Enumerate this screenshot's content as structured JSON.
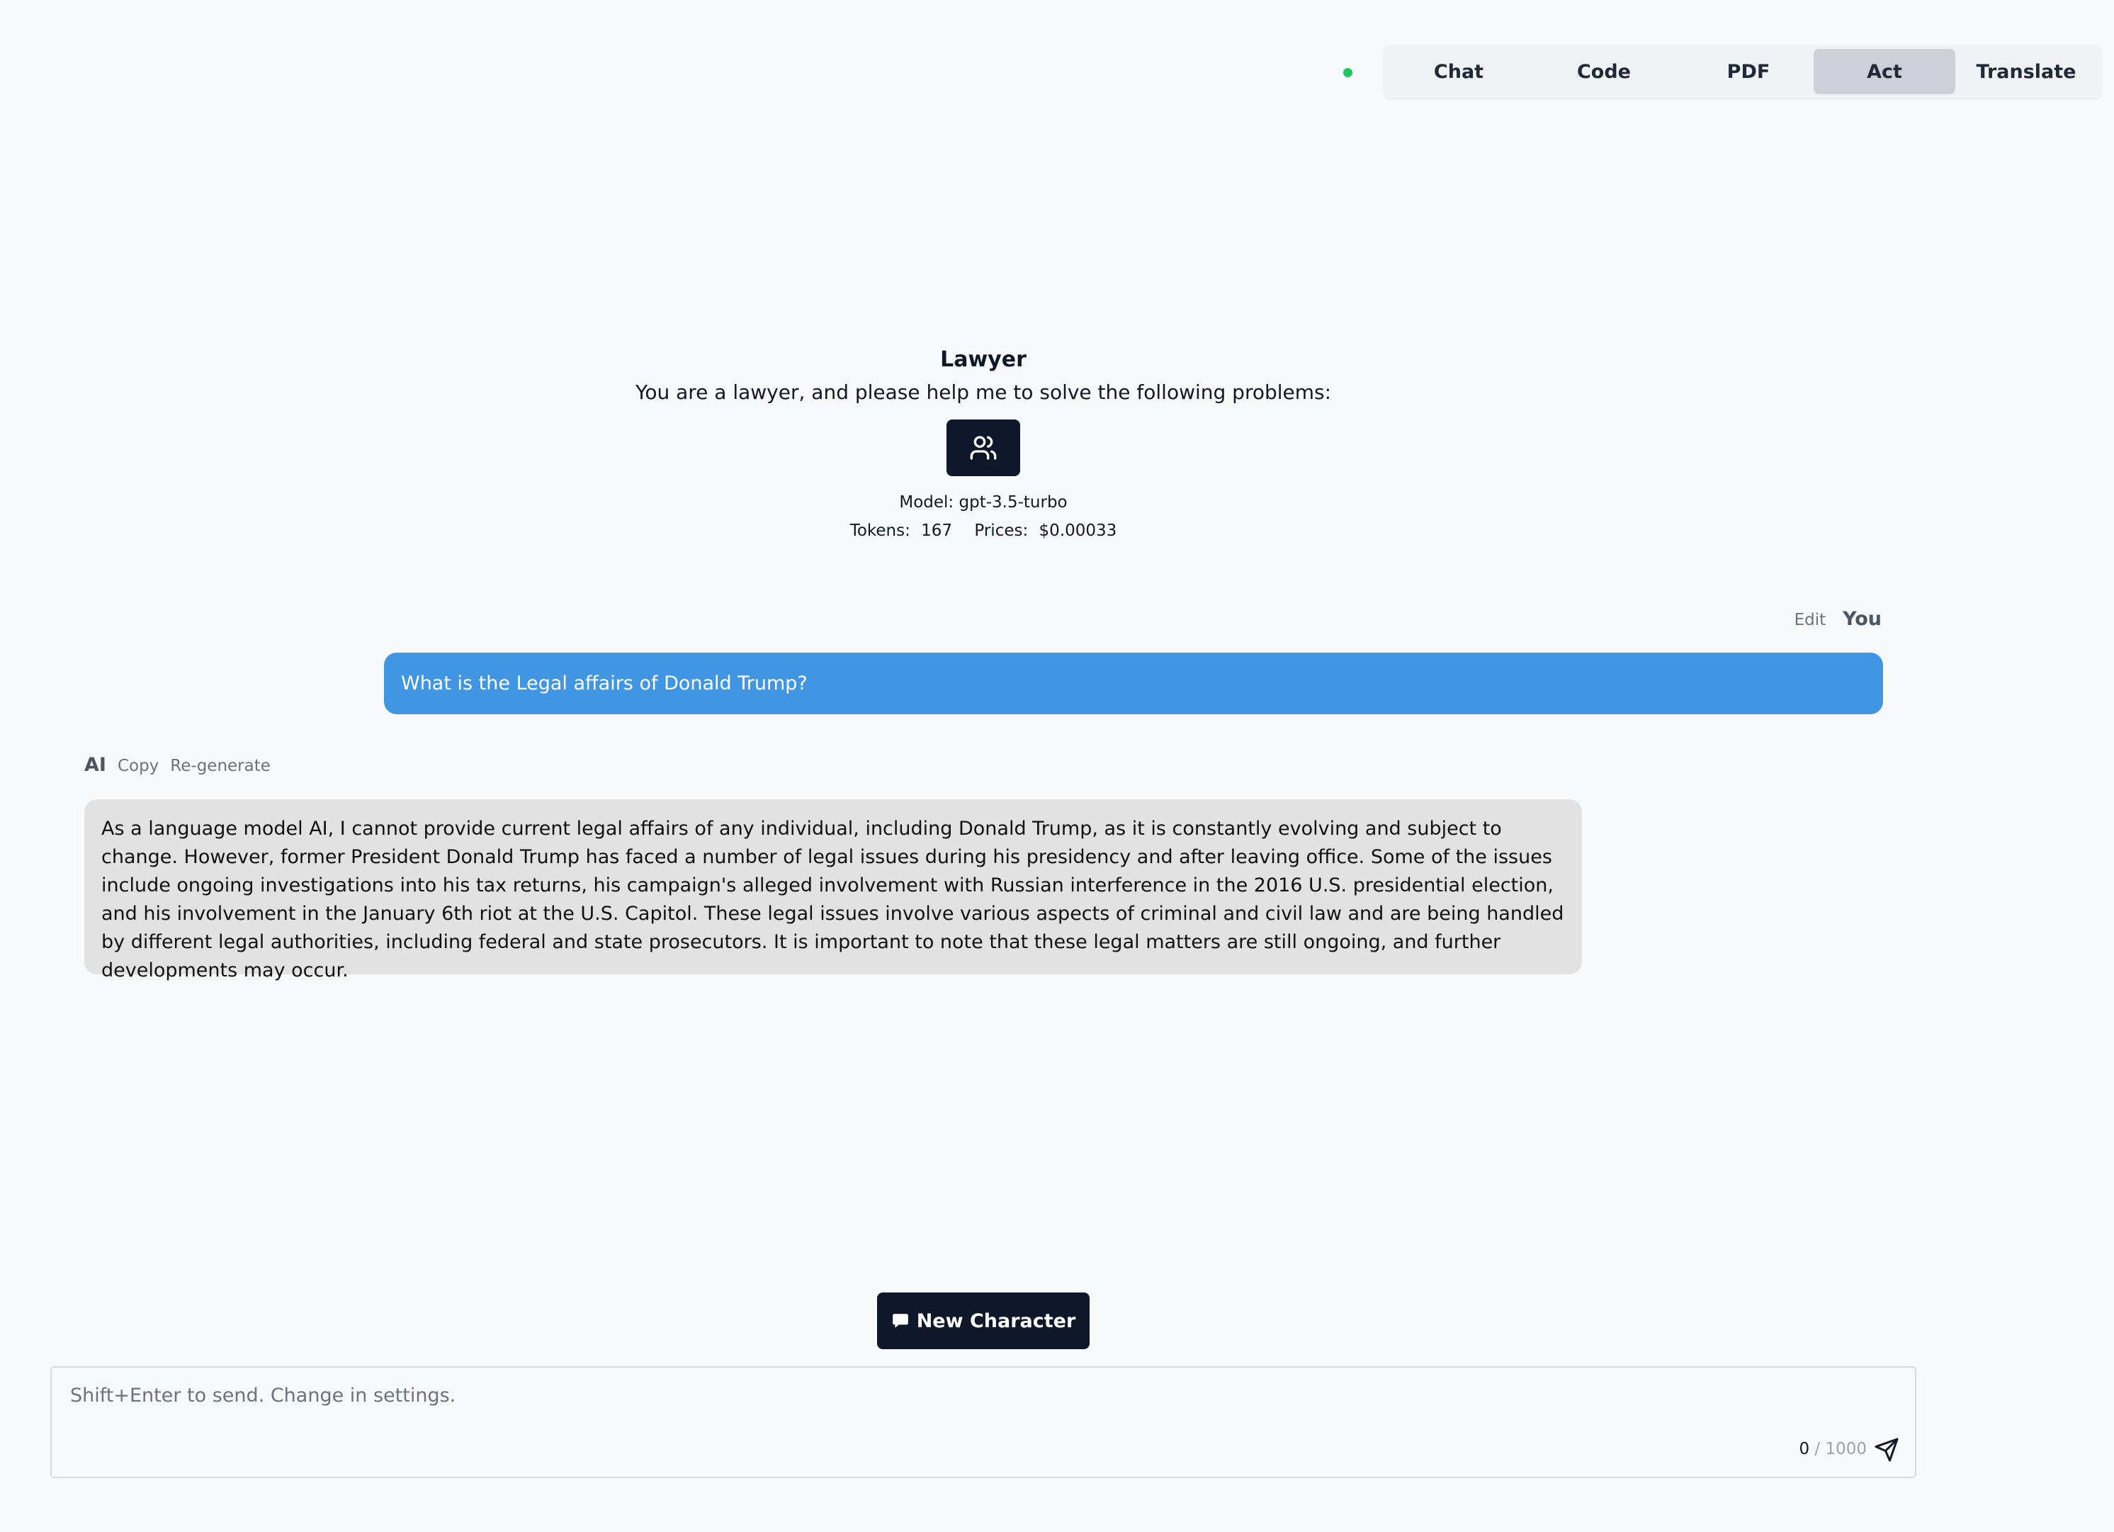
{
  "nav": {
    "tabs": [
      {
        "label": "Chat"
      },
      {
        "label": "Code"
      },
      {
        "label": "PDF"
      },
      {
        "label": "Act"
      },
      {
        "label": "Translate"
      }
    ],
    "active_tab": "Act",
    "status_color": "#22c55e"
  },
  "persona": {
    "title": "Lawyer",
    "description": "You are a lawyer, and please help me to solve the following problems:",
    "icon": "users-icon",
    "model_label": "Model:",
    "model": "gpt-3.5-turbo",
    "tokens_label": "Tokens:",
    "tokens": "167",
    "prices_label": "Prices:",
    "price": "$0.00033"
  },
  "conversation": {
    "user": {
      "edit_label": "Edit",
      "author": "You",
      "text": "What is the Legal affairs of Donald Trump?"
    },
    "ai": {
      "author": "AI",
      "copy_label": "Copy",
      "regenerate_label": "Re-generate",
      "text": "As a language model AI, I cannot provide current legal affairs of any individual, including Donald Trump, as it is constantly evolving and subject to change. However, former President Donald Trump has faced a number of legal issues during his presidency and after leaving office. Some of the issues include ongoing investigations into his tax returns, his campaign's alleged involvement with Russian interference in the 2016 U.S. presidential election, and his involvement in the January 6th riot at the U.S. Capitol. These legal issues involve various aspects of criminal and civil law and are being handled by different legal authorities, including federal and state prosecutors. It is important to note that these legal matters are still ongoing, and further developments may occur."
    }
  },
  "actions": {
    "new_character_label": "New Character"
  },
  "composer": {
    "placeholder": "Shift+Enter to send. Change in settings.",
    "value": "",
    "char_count": "0",
    "char_limit": "/ 1000"
  },
  "colors": {
    "accent_blue": "#4196e3",
    "dark": "#0f172a",
    "ai_bubble": "#e2e2e2"
  }
}
